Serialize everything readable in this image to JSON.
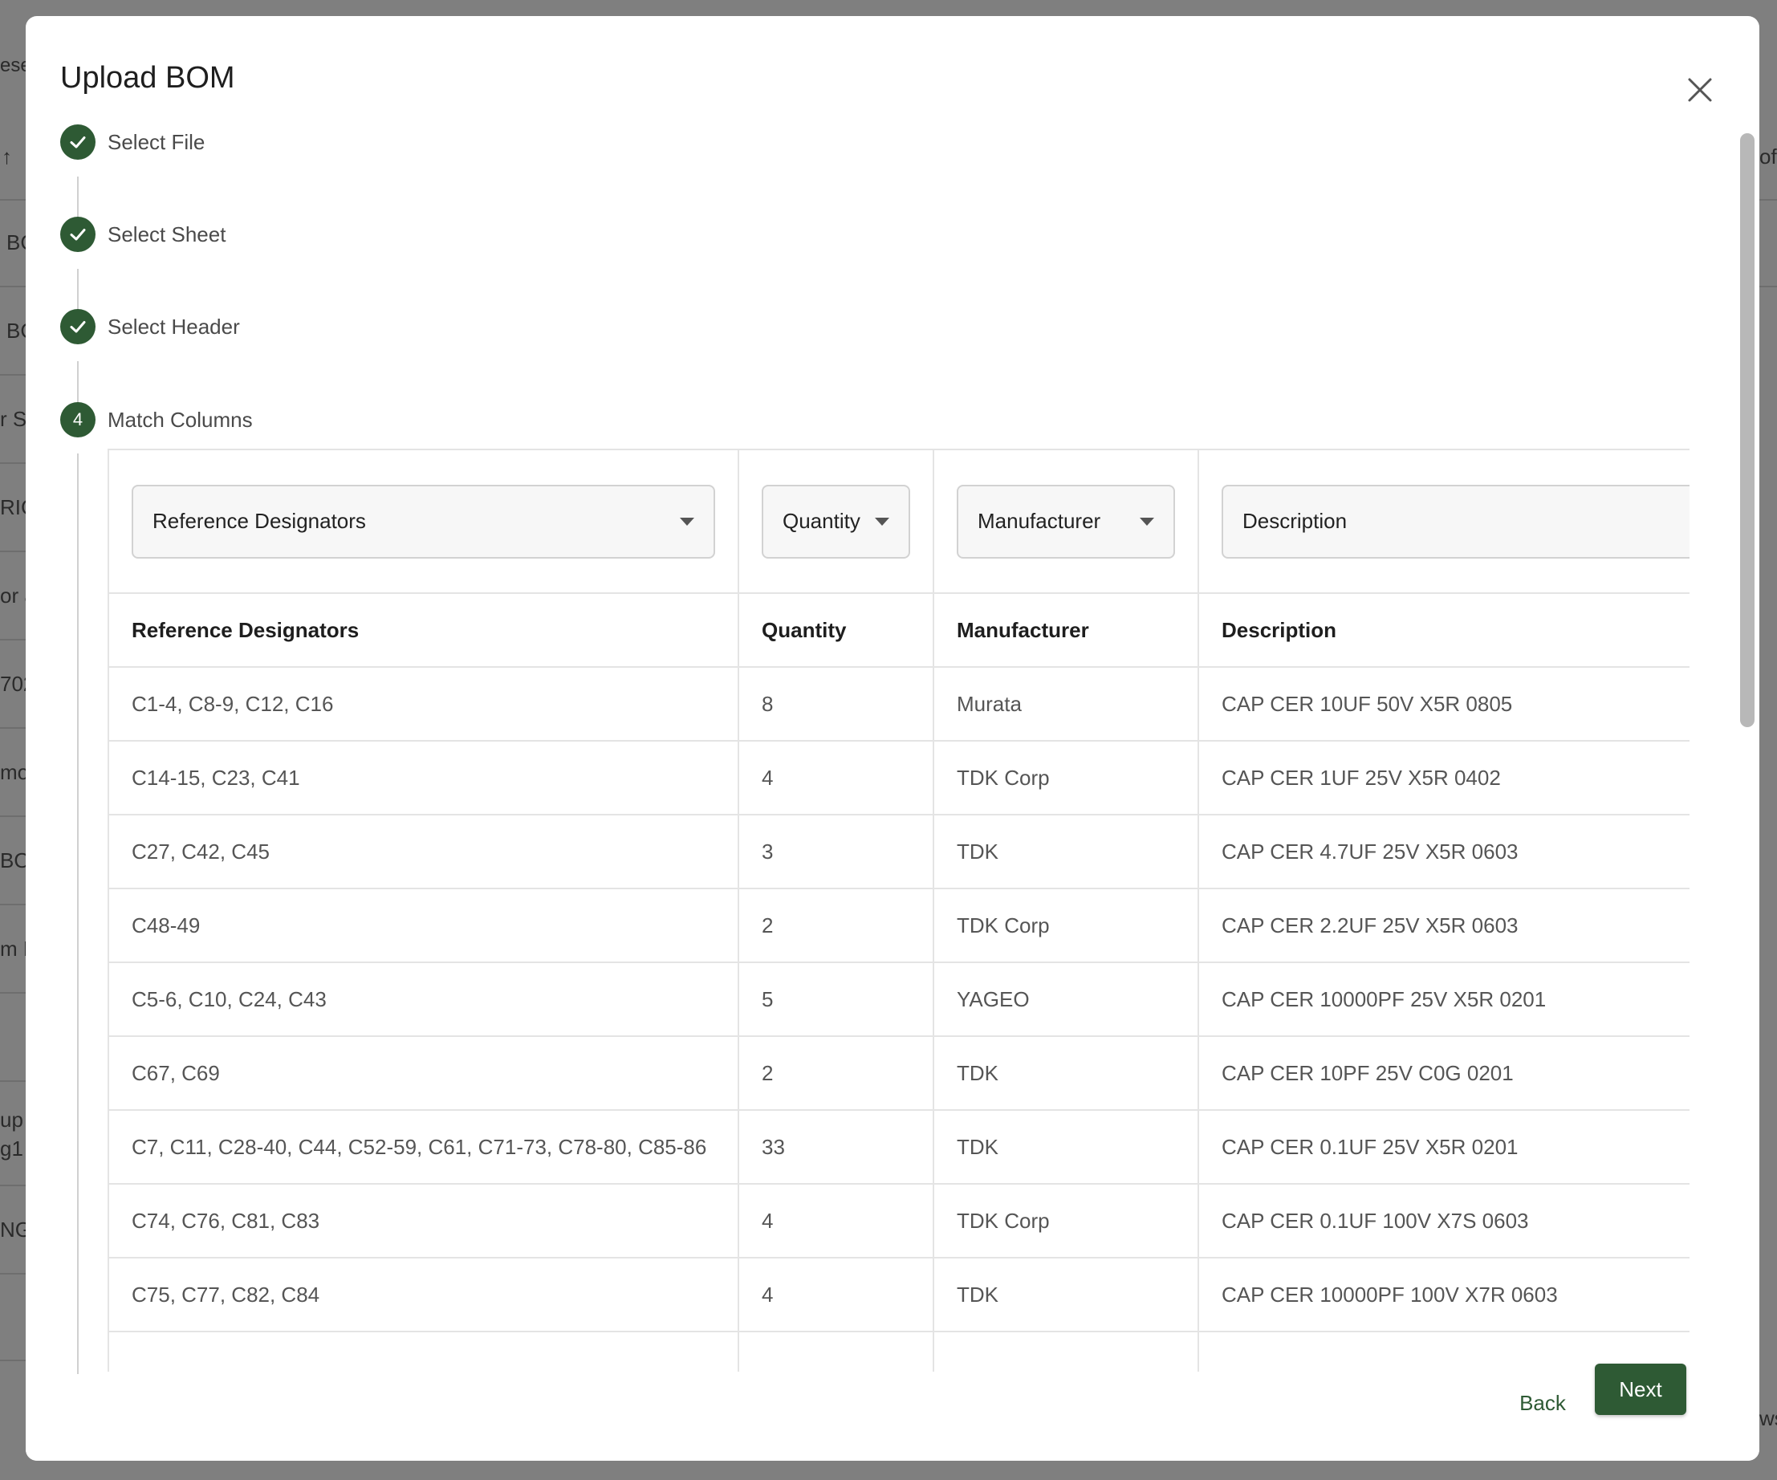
{
  "background": {
    "fragments_left": [
      "ese",
      "↑",
      "BC",
      "BC",
      "r S",
      "RIC",
      "or a",
      "702",
      "mo",
      "BO",
      "m E",
      "up",
      "g1",
      "NG"
    ],
    "fragments_right": [
      "of",
      "ws"
    ]
  },
  "modal": {
    "title": "Upload BOM",
    "close_icon": "close-icon"
  },
  "steps": [
    {
      "label": "Select File",
      "status": "done"
    },
    {
      "label": "Select Sheet",
      "status": "done"
    },
    {
      "label": "Select Header",
      "status": "done"
    },
    {
      "label": "Match Columns",
      "status": "current",
      "number": "4"
    }
  ],
  "column_selects": [
    {
      "value": "Reference Designators",
      "has_caret": true
    },
    {
      "value": "Quantity",
      "has_caret": true
    },
    {
      "value": "Manufacturer",
      "has_caret": true
    },
    {
      "value": "Description",
      "has_caret": false
    }
  ],
  "table": {
    "headers": [
      "Reference Designators",
      "Quantity",
      "Manufacturer",
      "Description"
    ],
    "rows": [
      [
        "C1-4, C8-9, C12, C16",
        "8",
        "Murata",
        "CAP CER 10UF 50V X5R 0805"
      ],
      [
        "C14-15, C23, C41",
        "4",
        "TDK Corp",
        "CAP CER 1UF 25V X5R 0402"
      ],
      [
        "C27, C42, C45",
        "3",
        "TDK",
        "CAP CER 4.7UF 25V X5R 0603"
      ],
      [
        "C48-49",
        "2",
        "TDK Corp",
        "CAP CER 2.2UF 25V X5R 0603"
      ],
      [
        "C5-6, C10, C24, C43",
        "5",
        "YAGEO",
        "CAP CER 10000PF 25V X5R 0201"
      ],
      [
        "C67, C69",
        "2",
        "TDK",
        "CAP CER 10PF 25V C0G 0201"
      ],
      [
        "C7, C11, C28-40, C44, C52-59, C61, C71-73, C78-80, C85-86",
        "33",
        "TDK",
        "CAP CER 0.1UF 25V X5R 0201"
      ],
      [
        "C74, C76, C81, C83",
        "4",
        "TDK Corp",
        "CAP CER 0.1UF 100V X7S 0603"
      ],
      [
        "C75, C77, C82, C84",
        "4",
        "TDK",
        "CAP CER 10000PF 100V X7R 0603"
      ]
    ]
  },
  "footer": {
    "back_label": "Back",
    "next_label": "Next"
  },
  "colors": {
    "accent": "#2e5a34",
    "overlay": "#7f7f7f"
  }
}
